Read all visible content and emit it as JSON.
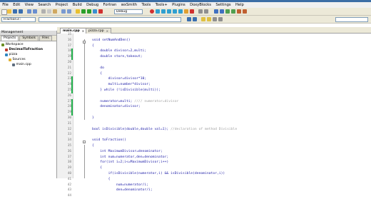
{
  "window": {
    "title": ""
  },
  "menu": [
    "File",
    "Edit",
    "View",
    "Search",
    "Project",
    "Build",
    "Debug",
    "Fortran",
    "wxSmith",
    "Tools",
    "Tools+",
    "Plugins",
    "DoxyBlocks",
    "Settings",
    "Help"
  ],
  "toolbar": {
    "build_target": "Debug"
  },
  "symbols_bar": {
    "scope": "Fraction3::",
    "symbol": ""
  },
  "management": {
    "title": "Management",
    "tabs": [
      "Projects",
      "Symbols",
      "Files"
    ],
    "active_tab": "Projects",
    "tree": [
      {
        "label": "Workspace",
        "depth": 0,
        "bold": false,
        "icon_color": "#6b8e23"
      },
      {
        "label": "DecimalToFraction",
        "depth": 1,
        "bold": true,
        "icon_color": "#c0392b"
      },
      {
        "label": "pizza",
        "depth": 1,
        "bold": false,
        "icon_color": "#2e86c1"
      },
      {
        "label": "Sources",
        "depth": 2,
        "bold": false,
        "icon_color": "#e0b030"
      },
      {
        "label": "main.cpp",
        "depth": 3,
        "bold": false,
        "icon_color": "#5d6d7e"
      }
    ]
  },
  "editor_tabs": [
    {
      "label": "main.cpp",
      "active": true
    },
    {
      "label": "pizza.cpp",
      "active": false
    }
  ],
  "code": {
    "lines": [
      {
        "n": "15",
        "text": "",
        "changed": false
      },
      {
        "n": "16",
        "text": "void setNumAndDen()",
        "changed": false
      },
      {
        "n": "17",
        "text": "{",
        "changed": false
      },
      {
        "n": "18",
        "text": "    double divisor=2,multi;",
        "changed": true
      },
      {
        "n": "19",
        "text": "    double store,takeout;",
        "changed": true
      },
      {
        "n": "20",
        "text": "",
        "changed": false
      },
      {
        "n": "21",
        "text": "    do",
        "changed": false
      },
      {
        "n": "22",
        "text": "    {",
        "changed": false
      },
      {
        "n": "23",
        "text": "        divisor=divisor*10;",
        "changed": true
      },
      {
        "n": "24",
        "text": "        multi=number*divisor;",
        "changed": true
      },
      {
        "n": "25",
        "text": "    } while (!isDivisible(multi));",
        "changed": true
      },
      {
        "n": "26",
        "text": "",
        "changed": false
      },
      {
        "n": "27",
        "text": "    numerator=multi; //// numerator=divisor",
        "changed": true
      },
      {
        "n": "28",
        "text": "    denominator=divisor;",
        "changed": true
      },
      {
        "n": "29",
        "text": "",
        "changed": true
      },
      {
        "n": "30",
        "text": "}",
        "changed": false
      },
      {
        "n": "31",
        "text": "",
        "changed": false
      },
      {
        "n": "32",
        "text": "bool isDivisible(double,double val=1); //declaration of method Divisible",
        "changed": false
      },
      {
        "n": "33",
        "text": "",
        "changed": false
      },
      {
        "n": "34",
        "text": "void toFraction()",
        "changed": false
      },
      {
        "n": "35",
        "text": "{",
        "changed": false
      },
      {
        "n": "36",
        "text": "    int MaximumDivisor=denominator;",
        "changed": false
      },
      {
        "n": "37",
        "text": "    int num=numerator,den=denominator;",
        "changed": false
      },
      {
        "n": "38",
        "text": "    for(int i=2;i<=MaximumDivisor;i++)",
        "changed": false
      },
      {
        "n": "39",
        "text": "    {",
        "changed": false
      },
      {
        "n": "40",
        "text": "        if(isDivisible(numerator,i) && isDivisible(denominator,i))",
        "changed": false
      },
      {
        "n": "41",
        "text": "        {",
        "changed": false
      },
      {
        "n": "42",
        "text": "            num=numerator/i;",
        "changed": false
      },
      {
        "n": "43",
        "text": "            den=denominator/i;",
        "changed": false
      },
      {
        "n": "44",
        "text": "",
        "changed": false
      }
    ]
  },
  "colors": {
    "change_marker": "#22b14c",
    "code_text": "#1a1aa6",
    "comment": "#a0a0a0"
  }
}
